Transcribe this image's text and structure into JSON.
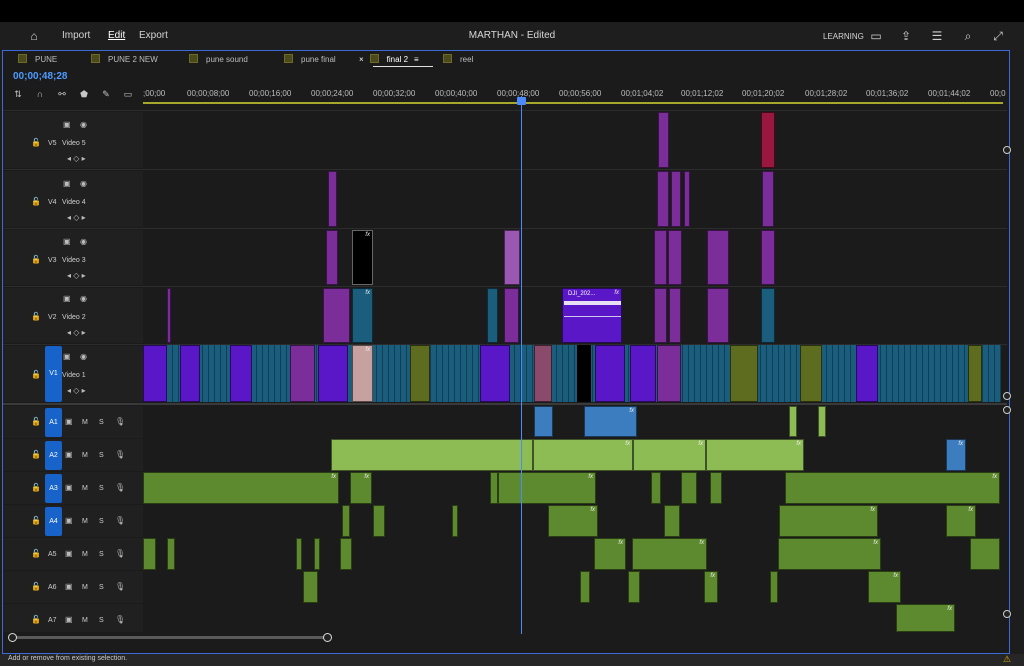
{
  "menu": {
    "home_icon": "home-icon",
    "import": "Import",
    "edit": "Edit",
    "export": "Export"
  },
  "document": {
    "title": "MARTHAN - Edited"
  },
  "workspace": {
    "learning": "LEARNING"
  },
  "sequence_tabs": [
    {
      "label": "PUNE"
    },
    {
      "label": "PUNE 2 NEW"
    },
    {
      "label": "pune sound"
    },
    {
      "label": "pune final"
    },
    {
      "label": "final 2",
      "active": true,
      "close": "×",
      "menu": "≡"
    },
    {
      "label": "reel"
    }
  ],
  "timeline": {
    "timecode": "00;00;48;28",
    "ruler_ticks": [
      ";00;00",
      "00;00;08;00",
      "00;00;16;00",
      "00;00;24;00",
      "00;00;32;00",
      "00;00;40;00",
      "00;00;48;00",
      "00;00;56;00",
      "00;01;04;02",
      "00;01;12;02",
      "00;01;20;02",
      "00;01;28;02",
      "00;01;36;02",
      "00;01;44;02",
      "00;0"
    ],
    "video_tracks": [
      {
        "id": "V5",
        "name": "Video 5"
      },
      {
        "id": "V4",
        "name": "Video 4"
      },
      {
        "id": "V3",
        "name": "Video 3"
      },
      {
        "id": "V2",
        "name": "Video 2"
      },
      {
        "id": "V1",
        "name": "Video 1",
        "target": true
      }
    ],
    "audio_tracks": [
      {
        "id": "A1",
        "m": "M",
        "s": "S",
        "target": true
      },
      {
        "id": "A2",
        "m": "M",
        "s": "S",
        "target": true
      },
      {
        "id": "A3",
        "m": "M",
        "s": "S",
        "target": true
      },
      {
        "id": "A4",
        "m": "M",
        "s": "S",
        "target": true
      },
      {
        "id": "A5",
        "m": "M",
        "s": "S"
      },
      {
        "id": "A6",
        "m": "M",
        "s": "S"
      },
      {
        "id": "A7",
        "m": "M",
        "s": "S"
      }
    ],
    "clip_labels": {
      "dji": "DJI_202...",
      "fx": "fx"
    }
  },
  "status": {
    "text": "Add or remove from existing selection.",
    "warning_icon": "warning-icon"
  },
  "colors": {
    "accent": "#4b8bff",
    "video_purple": "#7b2e9a",
    "video_violet": "#5a17c8",
    "video_teal": "#1b5d7d",
    "audio_green": "#5d8a2e"
  }
}
